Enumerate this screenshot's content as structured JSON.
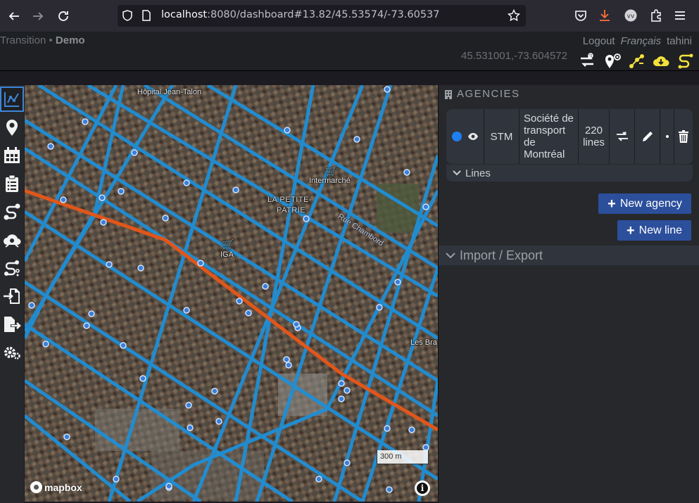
{
  "browser": {
    "url_host": "localhost",
    "url_rest": ":8080/dashboard#13.82/45.53574/-73.60537"
  },
  "header": {
    "app_name": "Transition",
    "separator": "•",
    "project": "Demo",
    "logout": "Logout",
    "language": "Français",
    "user": "tahini",
    "coordinates": "45.531001,-73.604572"
  },
  "map": {
    "labels": {
      "hospital": "Hôpital Jean-Talon",
      "neighborhood_1": "LA PETITE-",
      "neighborhood_2": "PATRIE",
      "poi_intermarche": "Intermarché",
      "poi_iga": "IGA",
      "poi_les_bra": "Les Bra",
      "rue_chambord": "Rue Chambord",
      "mapbox": "mapbox",
      "scale": "300 m",
      "info": "i"
    }
  },
  "panel": {
    "agencies_title": "AGENCIES",
    "agency": {
      "acronym": "STM",
      "name_l1": "Société de",
      "name_l2": "transport",
      "name_l3": "de",
      "name_l4": "Montréal",
      "lines_count_1": "220",
      "lines_count_2": "lines",
      "color": "#1e7ff0"
    },
    "lines_label": "Lines",
    "new_agency": "New agency",
    "new_line": "New line",
    "import_export": "Import / Export"
  },
  "colors": {
    "accent_blue": "#2c4f9c",
    "route_blue": "#1f8fd6",
    "route_orange": "#e0561a",
    "icon_yellow": "#f2e03a"
  }
}
